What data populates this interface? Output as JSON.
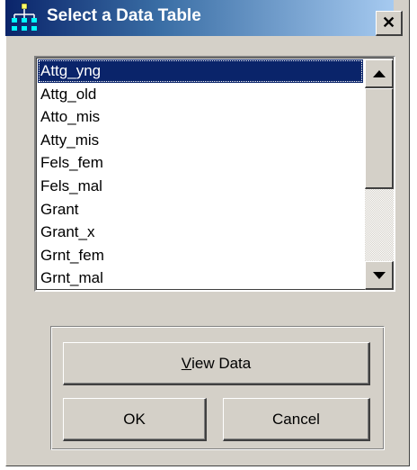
{
  "window": {
    "title": "Select a Data Table",
    "close_glyph": "✕"
  },
  "listbox": {
    "selected_index": 0,
    "items": [
      "Attg_yng",
      "Attg_old",
      "Atto_mis",
      "Atty_mis",
      "Fels_fem",
      "Fels_mal",
      "Grant",
      "Grant_x",
      "Grnt_fem",
      "Grnt_mal"
    ]
  },
  "buttons": {
    "view_data": {
      "mnemonic": "V",
      "rest": "iew Data"
    },
    "ok": "OK",
    "cancel": "Cancel"
  },
  "icons": {
    "title": "data-tree-icon",
    "scroll_up": "arrow-up-icon",
    "scroll_down": "arrow-down-icon"
  }
}
